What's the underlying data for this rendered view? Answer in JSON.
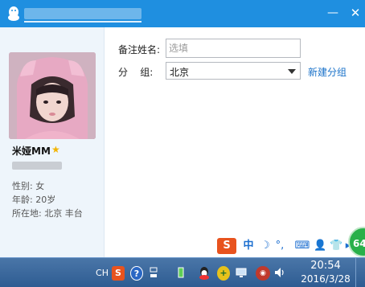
{
  "window": {
    "min_symbol": "—",
    "close_symbol": "✕"
  },
  "profile": {
    "nickname": "米娅MM",
    "gender_line": "性别: 女",
    "age_line": "年龄: 20岁",
    "location_line": "所在地: 北京 丰台"
  },
  "form": {
    "remark_label": "备注姓名:",
    "remark_placeholder": "选填",
    "group_label": "分    组:",
    "group_value": "北京",
    "new_group_link": "新建分组"
  },
  "ime_bar": {
    "sogou": "S",
    "language": "中",
    "moon": "☽",
    "punct": "°,",
    "keyboard": "⌨",
    "user": "👤",
    "shirt": "👕",
    "more": "▸",
    "speed_badge": "64"
  },
  "taskbar": {
    "lang": "CH",
    "sogou": "S",
    "help": "?",
    "clock_time": "20:54",
    "clock_date": "2016/3/28"
  },
  "colors": {
    "titlebar": "#1f8fe0",
    "link": "#1a72c9",
    "star": "#f2b400",
    "taskbar": "#2e5c92"
  }
}
